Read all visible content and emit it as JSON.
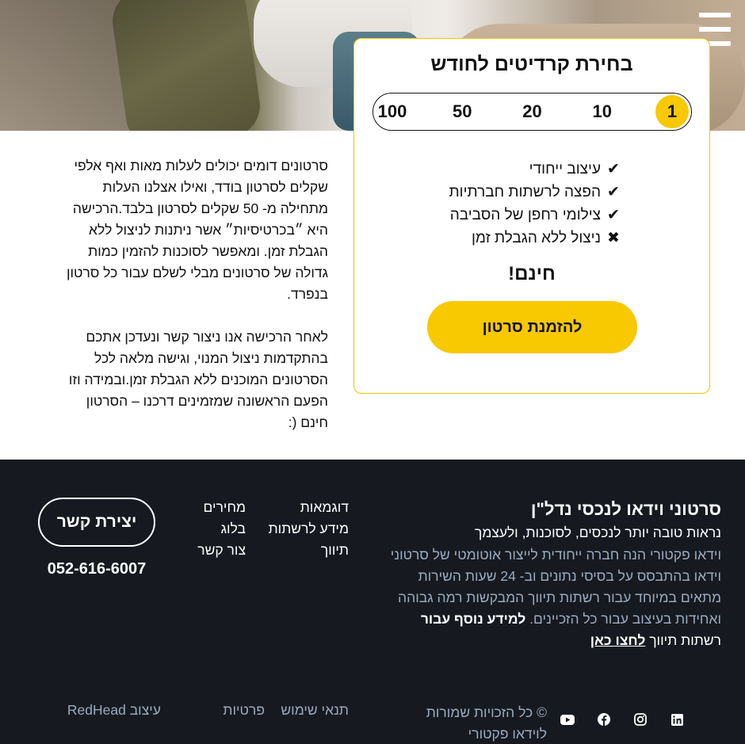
{
  "menu": {
    "icon": "hamburger-menu-icon"
  },
  "card": {
    "title": "בחירת קרדיטים לחודש",
    "credit_options": [
      "1",
      "10",
      "20",
      "50",
      "100"
    ],
    "selected_credit": "1",
    "features": [
      {
        "mark": "✔",
        "icon": "check-icon",
        "text": "עיצוב ייחודי"
      },
      {
        "mark": "✔",
        "icon": "check-icon",
        "text": "הפצה לרשתות חברתיות"
      },
      {
        "mark": "✔",
        "icon": "check-icon",
        "text": "צילומי רחפן של הסביבה"
      },
      {
        "mark": "✖",
        "icon": "x-icon",
        "text": "ניצול ללא הגבלת זמן"
      }
    ],
    "price": "חינם!",
    "order_button": "להזמנת סרטון"
  },
  "body": {
    "paragraph1": "סרטונים דומים יכולים לעלות מאות ואף אלפי שקלים לסרטון בודד, ואילו אצלנו העלות מתחילה מ- 50 שקלים לסרטון בלבד.הרכישה היא ״בכרטיסיות״ אשר ניתנות לניצול ללא הגבלת זמן. ומאפשר לסוכנות להזמין כמות גדולה של סרטונים מבלי לשלם עבור כל סרטון בנפרד.",
    "paragraph2": "לאחר הרכישה אנו ניצור קשר ונעדכן אתכם בהתקדמות ניצול המנוי, וגישה מלאה לכל הסרטונים המוכנים ללא הגבלת זמן.ובמידה וזו הפעם הראשונה שמזמינים דרכנו – הסרטון חינם (:"
  },
  "footer": {
    "title": "סרטוני וידאו לנכסי נדל\"ן",
    "subtitle": "נראות טובה יותר לנכסים, לסוכנות, ולעצמך",
    "description": "וידאו פקטורי הנה חברה ייחודית לייצור אוטומטי של סרטוני וידאו בהתבסס על בסיסי נתונים וב- 24 שעות השירות מתאים במיוחד עבור רשתות תיווך המבקשות רמה גבוהה ואחידות בעיצוב עבור כל הזכיינים.",
    "more_info_bold": "למידע נוסף עבור",
    "more_info_plain": "רשתות תיווך",
    "more_info_link": "לחצו כאן",
    "links_col1": [
      "דוגמאות",
      "מידע לרשתות",
      "תיווך"
    ],
    "links_col2": [
      "מחירים",
      "בלוג",
      "צור קשר"
    ],
    "contact_button": "יצירת קשר",
    "phone": "052-616-6007",
    "copyright": "© כל הזכויות שמורות לוידאו פקטורי",
    "terms": "תנאי שימוש",
    "privacy": "פרטיות",
    "design_credit": "עיצוב RedHead",
    "socials": [
      "linkedin-icon",
      "instagram-icon",
      "facebook-icon",
      "youtube-icon"
    ]
  }
}
